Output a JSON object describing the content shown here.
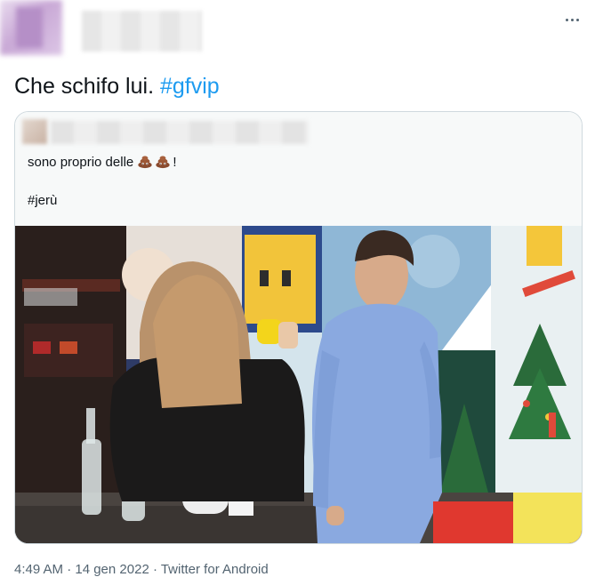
{
  "tweet": {
    "text": "Che schifo lui. ",
    "hashtag": "#gfvip"
  },
  "quote": {
    "text": "sono proprio delle ",
    "text_suffix": "!",
    "hashtag": "#jerù"
  },
  "footer": {
    "meta": "4:49 AM · 14 gen 2022 · Twitter for Android"
  },
  "colors": {
    "accent": "#1d9bf0",
    "text": "#0f1419",
    "muted": "#536471",
    "border": "#cfd9de"
  }
}
